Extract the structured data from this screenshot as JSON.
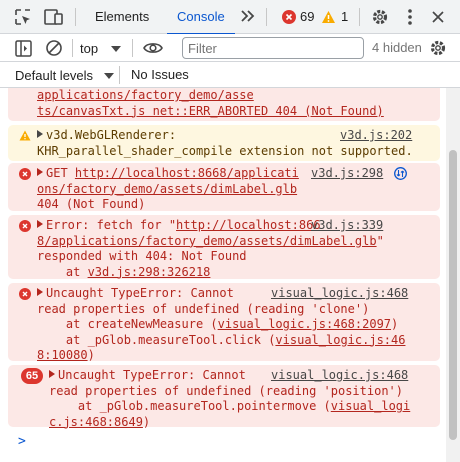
{
  "tabs": {
    "elements": "Elements",
    "console": "Console",
    "more": ">>"
  },
  "counters": {
    "errors": "69",
    "warnings": "1"
  },
  "toolbar": {
    "context": "top",
    "filter_placeholder": "Filter",
    "hidden": "4 hidden",
    "levels": "Default levels",
    "issues": "No Issues"
  },
  "messages": [
    {
      "type": "error",
      "lines": [
        "applications/factory_demo/asse",
        "ts/canvasTxt.js net::ERR_ABORTED 404 (Not Found)"
      ]
    },
    {
      "type": "warning",
      "text1": "v3d.WebGLRenderer:",
      "source": "v3d.js:202",
      "text2": "KHR_parallel_shader_compile extension not supported."
    },
    {
      "type": "error",
      "prefix": "GET ",
      "url1": "http://localhost:8668/applicati",
      "source": "v3d.js:298",
      "url2": "ons/factory_demo/assets/dimLabel.glb",
      "text3": "404 (Not Found)"
    },
    {
      "type": "error",
      "prefix": "Error: fetch for \"",
      "url1": "http://localhost:866",
      "source": "v3d.js:339",
      "url2": "8/applications/factory_demo/assets/dimLabel.glb",
      "suffix": "\"",
      "text3": "responded with 404: Not Found",
      "at_prefix": "    at ",
      "at_link": "v3d.js:298:326218"
    },
    {
      "type": "error",
      "text1": "Uncaught TypeError: Cannot",
      "source": "visual_logic.js:468",
      "text2": "read properties of undefined (reading 'clone')",
      "at1_prefix": "    at createNewMeasure (",
      "at1_link": "visual_logic.js:468:2097",
      "at1_suffix": ")",
      "at2_prefix": "    at _pGlob.measureTool.click (",
      "at2_link": "visual_logic.js:46",
      "at2_link2": "8:10080",
      "at2_suffix": ")"
    },
    {
      "type": "error",
      "count": "65",
      "text1": "Uncaught TypeError: Cannot",
      "source": "visual_logic.js:468",
      "text2": "read properties of undefined (reading 'position')",
      "at1_prefix": "    at _pGlob.measureTool.pointermove (",
      "at1_link": "visual_logi",
      "at1_link2": "c.js:468:8649",
      "at1_suffix": ")"
    }
  ],
  "prompt": ">",
  "colors": {
    "accent": "#0b57d0",
    "error_bg": "#fce8e6",
    "error_text": "#b3261e",
    "warn_bg": "#fef7e0",
    "error_icon": "#dc362e",
    "warn_icon": "#f9ab00"
  },
  "icons": [
    "inspect-icon",
    "device-toggle-icon",
    "more-tabs-icon",
    "error-icon",
    "warning-icon",
    "settings-gear-icon",
    "more-vert-icon",
    "close-icon",
    "sidebar-icon",
    "clear-console-icon",
    "eye-icon",
    "settings-icon",
    "network-icon"
  ]
}
